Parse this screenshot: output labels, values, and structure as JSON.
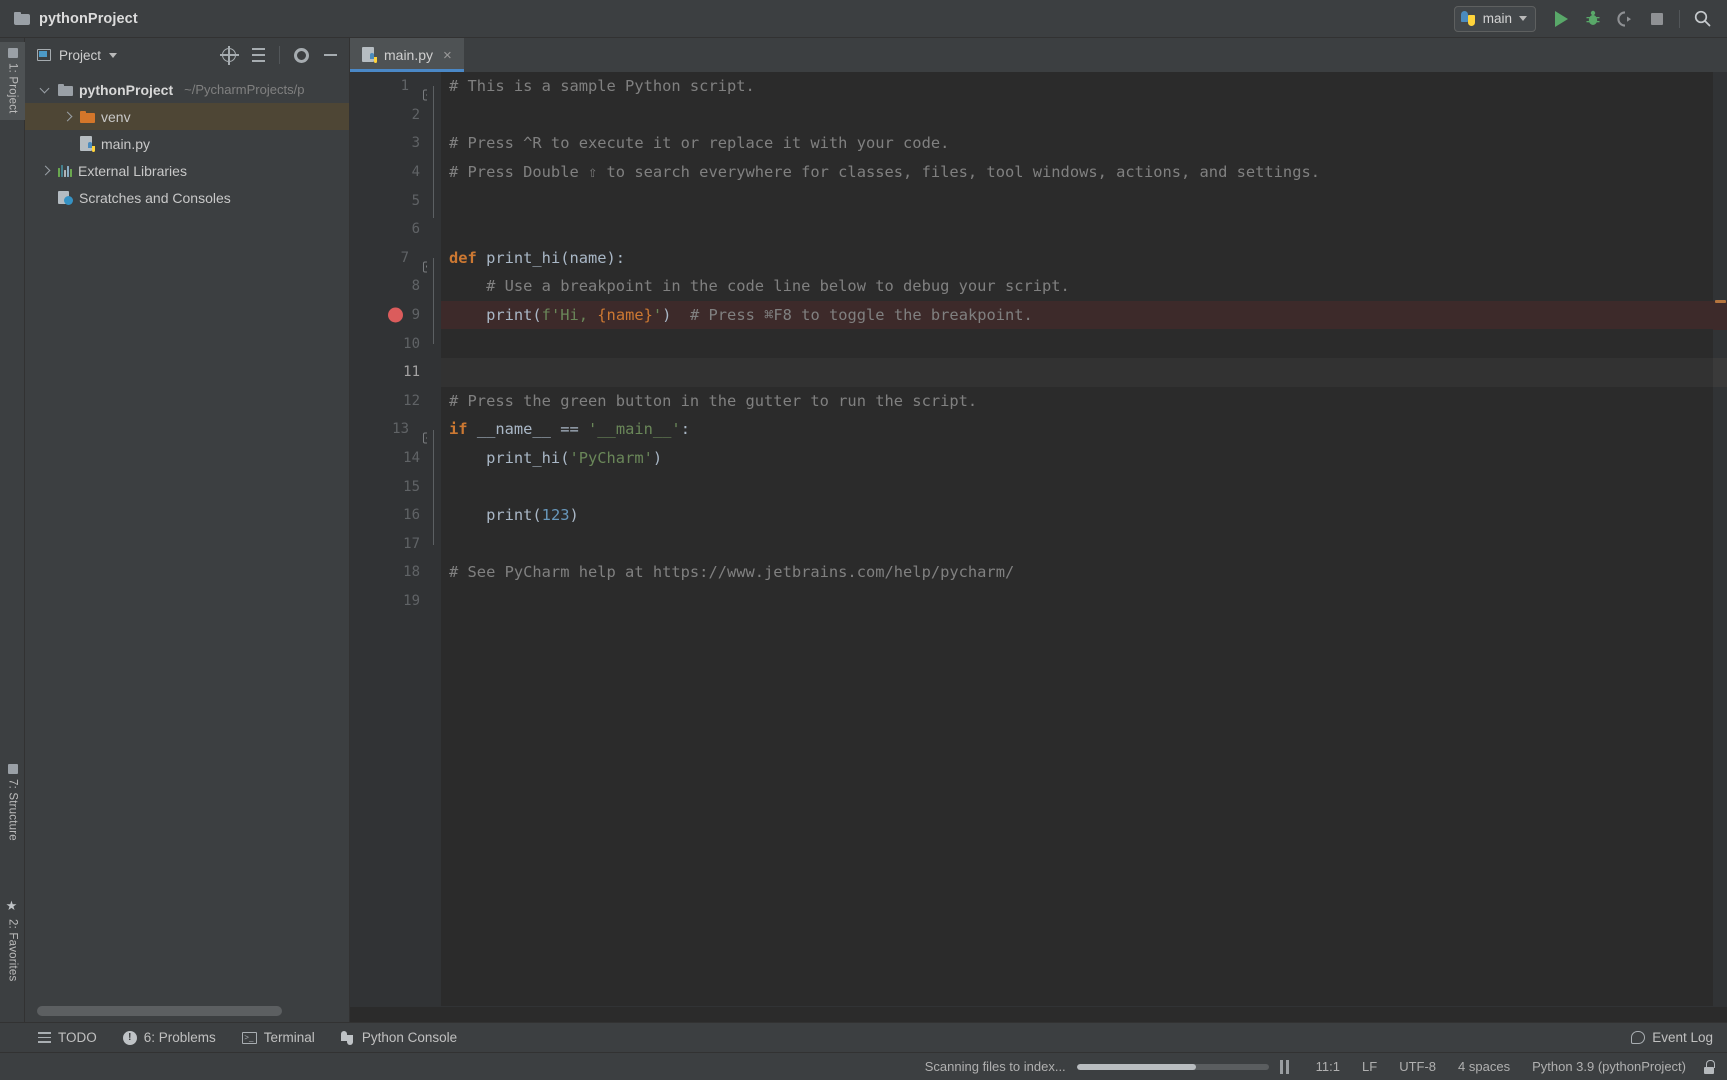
{
  "titlebar": {
    "project_name": "pythonProject",
    "folder_icon": "folder-icon",
    "run_config": {
      "label": "main",
      "icon": "python-file-icon",
      "caret": "chevron-down-icon"
    },
    "actions": [
      {
        "name": "run-button",
        "icon": "run-triangle-icon"
      },
      {
        "name": "debug-button",
        "icon": "bug-icon"
      },
      {
        "name": "run-with-coverage-button",
        "icon": "coverage-icon"
      },
      {
        "name": "stop-button",
        "icon": "stop-square-icon"
      },
      {
        "name": "search-everywhere-button",
        "icon": "search-icon"
      }
    ]
  },
  "left_strip": {
    "tabs": [
      {
        "label": "1: Project",
        "underline": "1",
        "icon": "project-window-icon",
        "active": true
      },
      {
        "label": "7: Structure",
        "underline": "7",
        "icon": "structure-icon",
        "active": false
      },
      {
        "label": "2: Favorites",
        "underline": "2",
        "icon": "star-icon",
        "active": false
      }
    ]
  },
  "project_panel": {
    "title": "Project",
    "title_caret": "chevron-down-icon",
    "toolbar": [
      {
        "name": "select-opened-file-button",
        "icon": "target-icon"
      },
      {
        "name": "collapse-all-button",
        "icon": "collapse-all-icon"
      },
      {
        "name": "settings-button",
        "icon": "gear-icon"
      },
      {
        "name": "hide-button",
        "icon": "minus-icon"
      }
    ],
    "tree": [
      {
        "label": "pythonProject",
        "sub": "~/PycharmProjects/p",
        "icon": "folder-icon",
        "arrow": "down",
        "indent": 0,
        "bold": true,
        "selected": false
      },
      {
        "label": "venv",
        "sub": "",
        "icon": "folder-orange-icon",
        "arrow": "right",
        "indent": 1,
        "bold": false,
        "selected": true
      },
      {
        "label": "main.py",
        "sub": "",
        "icon": "python-file-icon",
        "arrow": "none",
        "indent": 1,
        "bold": false,
        "selected": false
      },
      {
        "label": "External Libraries",
        "sub": "",
        "icon": "libraries-icon",
        "arrow": "right",
        "indent": 0,
        "bold": false,
        "selected": false
      },
      {
        "label": "Scratches and Consoles",
        "sub": "",
        "icon": "scratches-icon",
        "arrow": "none",
        "indent": 0,
        "bold": false,
        "selected": false
      }
    ]
  },
  "editor": {
    "tabs": [
      {
        "label": "main.py",
        "icon": "python-file-icon",
        "close": "×",
        "active": true
      }
    ],
    "caret_line": 11,
    "breakpoint_line": 9,
    "lines": [
      {
        "n": 1,
        "fold": "minus",
        "segments": [
          {
            "t": "# This is a sample Python script.",
            "c": "cmt"
          }
        ]
      },
      {
        "n": 2,
        "fold": "",
        "segments": []
      },
      {
        "n": 3,
        "fold": "",
        "segments": [
          {
            "t": "# Press ^R to execute it or replace it with your code.",
            "c": "cmt"
          }
        ]
      },
      {
        "n": 4,
        "fold": "end",
        "segments": [
          {
            "t": "# Press Double ⇧ to search everywhere for classes, files, tool windows, actions, and settings.",
            "c": "cmt"
          }
        ]
      },
      {
        "n": 5,
        "fold": "",
        "segments": []
      },
      {
        "n": 6,
        "fold": "",
        "segments": []
      },
      {
        "n": 7,
        "fold": "minus",
        "segments": [
          {
            "t": "def ",
            "c": "kw"
          },
          {
            "t": "print_hi(name):",
            "c": "fn"
          }
        ]
      },
      {
        "n": 8,
        "fold": "",
        "segments": [
          {
            "t": "    # Use a breakpoint in the code line below to debug your script.",
            "c": "cmt"
          }
        ]
      },
      {
        "n": 9,
        "fold": "end",
        "segments": [
          {
            "t": "    print(",
            "c": "ident"
          },
          {
            "t": "f'Hi, ",
            "c": "str"
          },
          {
            "t": "{name}",
            "c": "fstr-brace"
          },
          {
            "t": "'",
            "c": "str"
          },
          {
            "t": ")",
            "c": "ident"
          },
          {
            "t": "  # Press ⌘F8 to toggle the breakpoint.",
            "c": "cmt"
          }
        ]
      },
      {
        "n": 10,
        "fold": "",
        "segments": []
      },
      {
        "n": 11,
        "fold": "",
        "segments": []
      },
      {
        "n": 12,
        "fold": "",
        "segments": [
          {
            "t": "# Press the green button in the gutter to run the script.",
            "c": "cmt"
          }
        ]
      },
      {
        "n": 13,
        "fold": "minus",
        "segments": [
          {
            "t": "if ",
            "c": "kw"
          },
          {
            "t": "__name__ == ",
            "c": "ident"
          },
          {
            "t": "'__main__'",
            "c": "str"
          },
          {
            "t": ":",
            "c": "ident"
          }
        ]
      },
      {
        "n": 14,
        "fold": "",
        "segments": [
          {
            "t": "    print_hi(",
            "c": "ident"
          },
          {
            "t": "'PyCharm'",
            "c": "str"
          },
          {
            "t": ")",
            "c": "ident"
          }
        ]
      },
      {
        "n": 15,
        "fold": "",
        "segments": []
      },
      {
        "n": 16,
        "fold": "end",
        "segments": [
          {
            "t": "    print(",
            "c": "ident"
          },
          {
            "t": "123",
            "c": "num"
          },
          {
            "t": ")",
            "c": "ident"
          }
        ]
      },
      {
        "n": 17,
        "fold": "",
        "segments": []
      },
      {
        "n": 18,
        "fold": "",
        "segments": [
          {
            "t": "# See PyCharm help at https://www.jetbrains.com/help/pycharm/",
            "c": "cmt"
          }
        ]
      },
      {
        "n": 19,
        "fold": "",
        "segments": []
      }
    ]
  },
  "bottom_toolbar": {
    "items": [
      {
        "label": "TODO",
        "underline": "",
        "icon": "todo-list-icon"
      },
      {
        "label": "6: Problems",
        "underline": "6",
        "icon": "problems-warning-icon"
      },
      {
        "label": "Terminal",
        "underline": "",
        "icon": "terminal-icon"
      },
      {
        "label": "Python Console",
        "underline": "",
        "icon": "python-console-icon"
      }
    ],
    "event_log": {
      "label": "Event Log",
      "icon": "bubble-icon"
    }
  },
  "statusbar": {
    "scanning_text": "Scanning files to index...",
    "progress_percent": 62,
    "pause_icon": "pause-icon",
    "caret_position": "11:1",
    "line_separator": "LF",
    "encoding": "UTF-8",
    "indent": "4 spaces",
    "interpreter": "Python 3.9 (pythonProject)",
    "lock_icon": "lock-icon"
  },
  "colors": {
    "accent_blue": "#4a88c7",
    "bg_chrome": "#3c3f41",
    "bg_editor": "#2b2b2b",
    "gutter": "#313335",
    "selection_olive": "#4e4635",
    "breakpoint_red": "#db5c5c",
    "breakpoint_line_bg": "#3d2a2a",
    "keyword_orange": "#cc7832",
    "string_green": "#6a8759",
    "number_blue": "#6897bb",
    "comment_gray": "#808080",
    "run_green": "#59a869",
    "folder_orange": "#d4762a"
  }
}
